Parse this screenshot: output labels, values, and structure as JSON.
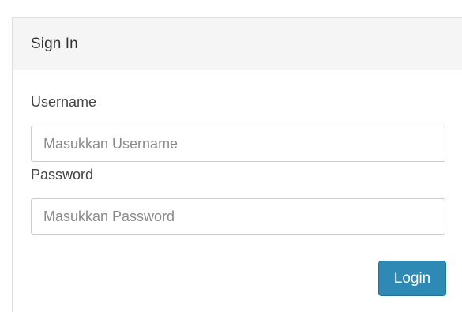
{
  "panel": {
    "title": "Sign In"
  },
  "form": {
    "username": {
      "label": "Username",
      "placeholder": "Masukkan Username",
      "value": ""
    },
    "password": {
      "label": "Password",
      "placeholder": "Masukkan Password",
      "value": ""
    },
    "submit_label": "Login"
  },
  "colors": {
    "accent": "#2e8ab5",
    "heading_bg": "#f5f5f5",
    "border": "#cccccc"
  }
}
